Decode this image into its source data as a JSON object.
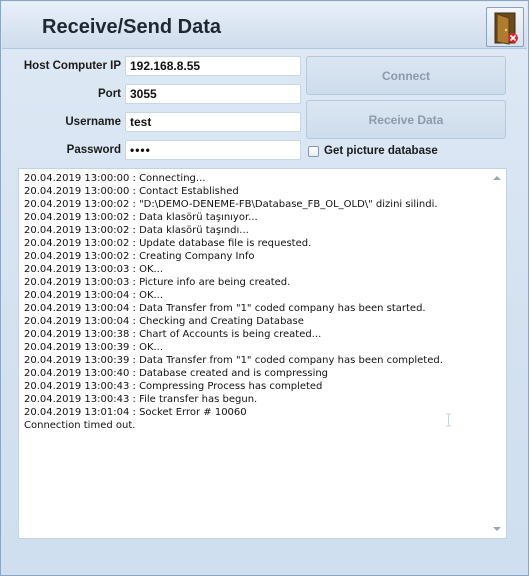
{
  "window": {
    "title": "Receive/Send Data"
  },
  "form": {
    "host_label": "Host Computer IP",
    "host_value": "192.168.8.55",
    "port_label": "Port",
    "port_value": "3055",
    "username_label": "Username",
    "username_value": "test",
    "password_label": "Password",
    "password_value": "••••"
  },
  "buttons": {
    "connect": "Connect",
    "receive": "Receive Data"
  },
  "options": {
    "picture_db_label": "Get picture database",
    "picture_db_checked": false
  },
  "log": [
    "20.04.2019 13:00:00 : Connecting...",
    "20.04.2019 13:00:00 : Contact Established",
    "20.04.2019 13:00:02 : \"D:\\DEMO-DENEME-FB\\Database_FB_OL_OLD\\\" dizini silindi.",
    "20.04.2019 13:00:02 : Data klasörü taşınıyor...",
    "20.04.2019 13:00:02 : Data klasörü taşındı...",
    "20.04.2019 13:00:02 : Update database file is requested.",
    "20.04.2019 13:00:02 : Creating Company Info",
    "20.04.2019 13:00:03 : OK...",
    "20.04.2019 13:00:03 : Picture info are being created.",
    "20.04.2019 13:00:04 : OK...",
    "20.04.2019 13:00:04 : Data Transfer from \"1\" coded company has been started.",
    "20.04.2019 13:00:04 : Checking and Creating Database",
    "20.04.2019 13:00:38 : Chart of Accounts is being created...",
    "20.04.2019 13:00:39 : OK...",
    "20.04.2019 13:00:39 : Data Transfer from \"1\" coded company has been completed.",
    "20.04.2019 13:00:40 : Database created and is compressing",
    "20.04.2019 13:00:43 : Compressing Process has completed",
    "20.04.2019 13:00:43 : File transfer has begun.",
    "20.04.2019 13:01:04 : Socket Error # 10060",
    "Connection timed out."
  ],
  "icons": {
    "exit": "exit-door-icon",
    "scroll_up": "scroll-up-arrow-icon",
    "scroll_down": "scroll-down-arrow-icon"
  }
}
